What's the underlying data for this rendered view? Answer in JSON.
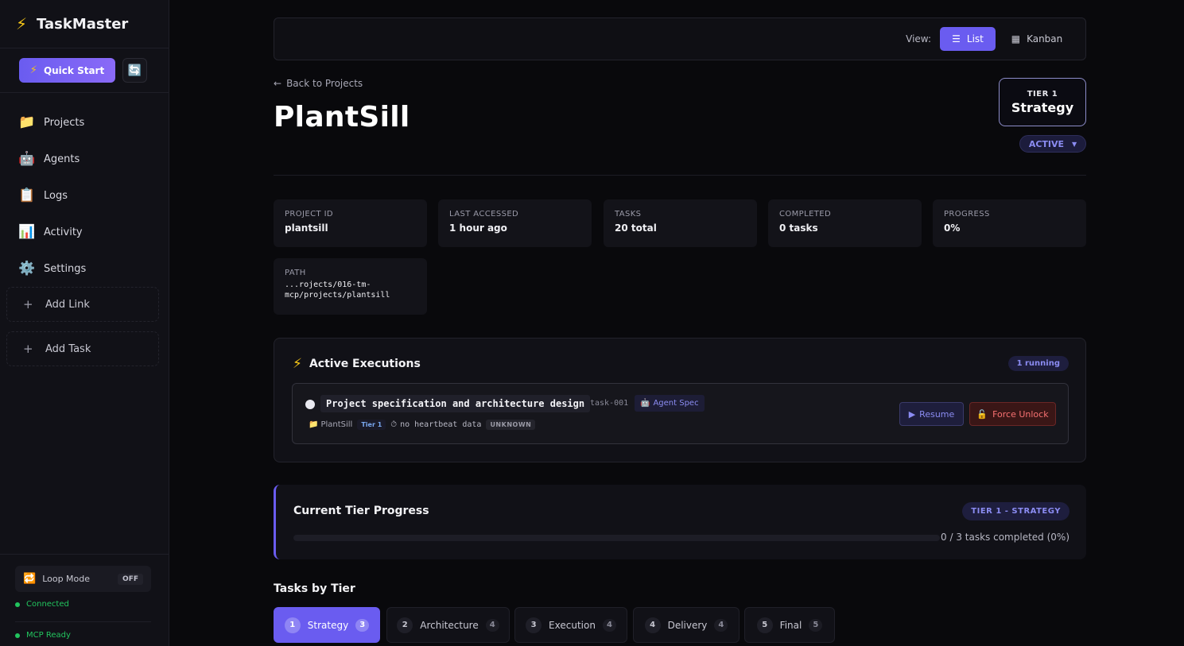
{
  "app": {
    "name": "TaskMaster"
  },
  "sidebar": {
    "quick_start": "Quick Start",
    "nav": [
      {
        "label": "Projects",
        "icon": "📁"
      },
      {
        "label": "Agents",
        "icon": "🤖"
      },
      {
        "label": "Logs",
        "icon": "📋"
      },
      {
        "label": "Activity",
        "icon": "📊"
      },
      {
        "label": "Settings",
        "icon": "⚙️"
      }
    ],
    "add_link": "Add Link",
    "add_task": "Add Task",
    "loop_mode": {
      "label": "Loop Mode",
      "state": "OFF"
    },
    "status": [
      "Connected",
      "MCP Ready"
    ]
  },
  "toolbar": {
    "view_label": "View:",
    "list": "List",
    "kanban": "Kanban"
  },
  "project": {
    "back": "Back to Projects",
    "title": "PlantSill",
    "tier_small": "TIER 1",
    "tier_big": "Strategy",
    "status": "ACTIVE"
  },
  "stats": [
    {
      "label": "PROJECT ID",
      "value": "plantsill"
    },
    {
      "label": "LAST ACCESSED",
      "value": "1 hour ago"
    },
    {
      "label": "TASKS",
      "value": "20 total"
    },
    {
      "label": "COMPLETED",
      "value": "0 tasks"
    },
    {
      "label": "PROGRESS",
      "value": "0%"
    }
  ],
  "path": {
    "label": "PATH",
    "line1": "...rojects/016-tm-",
    "line2": "mcp/projects/plantsill"
  },
  "executions": {
    "title": "Active Executions",
    "badge": "1 running",
    "task": {
      "name": "Project specification and architecture design",
      "id": "task-001",
      "agent": "Agent Spec",
      "project": "PlantSill",
      "tier": "Tier 1",
      "heartbeat": "no heartbeat data",
      "state": "UNKNOWN"
    },
    "resume": "Resume",
    "force_unlock": "Force Unlock"
  },
  "tier_progress": {
    "title": "Current Tier Progress",
    "badge": "TIER 1 - STRATEGY",
    "text": "0 / 3 tasks completed (0%)",
    "fraction": 0
  },
  "tiers": {
    "title": "Tasks by Tier",
    "items": [
      {
        "num": "1",
        "label": "Strategy",
        "count": "3"
      },
      {
        "num": "2",
        "label": "Architecture",
        "count": "4"
      },
      {
        "num": "3",
        "label": "Execution",
        "count": "4"
      },
      {
        "num": "4",
        "label": "Delivery",
        "count": "4"
      },
      {
        "num": "5",
        "label": "Final",
        "count": "5"
      }
    ]
  },
  "colors": {
    "accent": "#6a5cf0",
    "success": "#22c55e",
    "danger": "#f87171"
  }
}
